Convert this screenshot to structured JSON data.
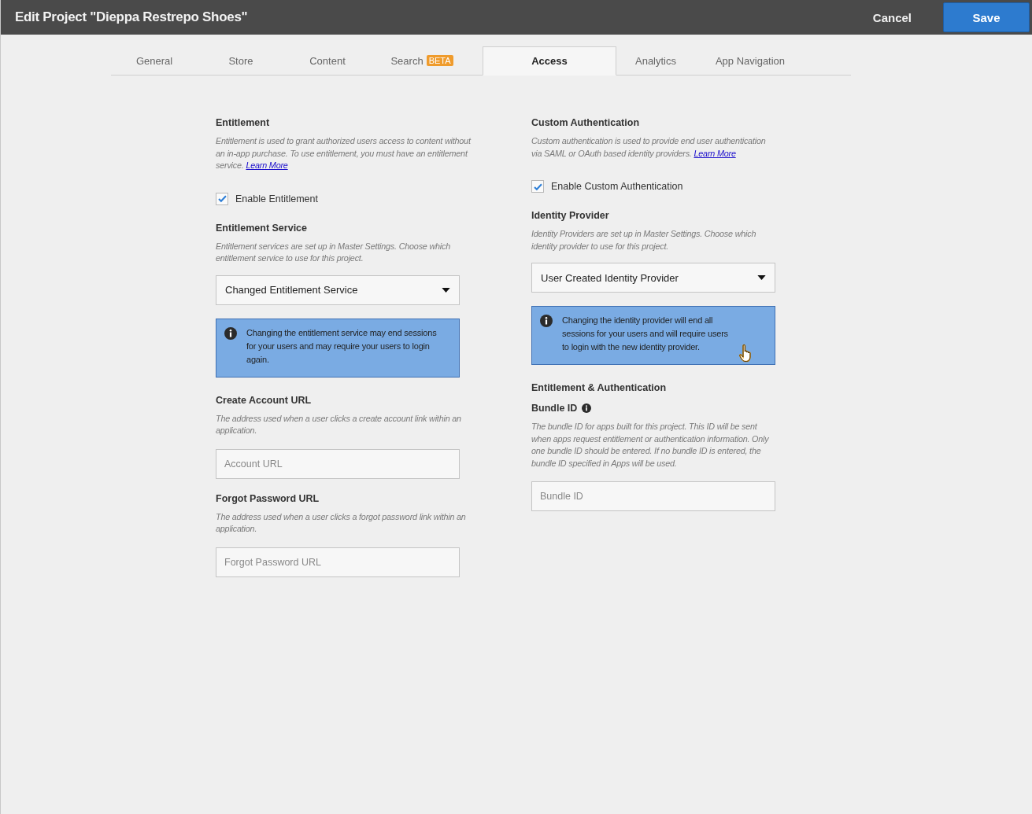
{
  "window": {
    "title": "Edit Project \"Dieppa Restrepo Shoes\""
  },
  "actions": [
    {
      "label": "Cancel",
      "kind": "link"
    },
    {
      "label": "Save",
      "kind": "primary"
    }
  ],
  "tabs": [
    {
      "label": "General",
      "selected": false
    },
    {
      "label": "Store",
      "selected": false
    },
    {
      "label": "Content",
      "selected": false
    },
    {
      "label": "Search",
      "badge": "BETA",
      "selected": false
    },
    {
      "label": "Access",
      "selected": true
    },
    {
      "label": "Analytics",
      "selected": false
    },
    {
      "label": "App Navigation",
      "selected": false
    }
  ],
  "columns": [
    [
      {
        "kind": "heading",
        "text": "Entitlement"
      },
      {
        "kind": "description",
        "text": "Entitlement is used to grant authorized users access to content without an  in-app purchase. To use  entitlement, you must have an entitlement service.",
        "link": "Learn More"
      },
      {
        "kind": "checkbox",
        "label": "Enable Entitlement",
        "checked": true
      },
      {
        "kind": "heading",
        "text": "Entitlement Service"
      },
      {
        "kind": "description",
        "text": "Entitlement services are set up in Master Settings. Choose which entitlement service to use for this  project."
      },
      {
        "kind": "dropdown",
        "value": "Changed Entitlement Service"
      },
      {
        "kind": "alert",
        "text": "Changing the entitlement service may end sessions for your users and may require your users to login again."
      },
      {
        "kind": "heading",
        "text": "Create Account URL"
      },
      {
        "kind": "description",
        "text": "The address used when a user clicks a create account link within an application."
      },
      {
        "kind": "input",
        "placeholder": "Account URL"
      },
      {
        "kind": "heading",
        "text": "Forgot Password URL"
      },
      {
        "kind": "description",
        "text": "The address used when a user clicks a forgot password link within an application."
      },
      {
        "kind": "input",
        "placeholder": "Forgot Password URL"
      }
    ],
    [
      {
        "kind": "heading",
        "text": "Custom Authentication"
      },
      {
        "kind": "description",
        "text": "Custom authentication is used to provide end user authentication via SAML or OAuth based identity providers.",
        "link": "Learn More"
      },
      {
        "kind": "checkbox",
        "label": "Enable Custom Authentication",
        "checked": true
      },
      {
        "kind": "heading",
        "text": "Identity Provider"
      },
      {
        "kind": "description",
        "text": "Identity Providers are set up in Master Settings.  Choose which identity provider to use for this project."
      },
      {
        "kind": "dropdown",
        "value": "User Created Identity Provider"
      },
      {
        "kind": "alert",
        "text": "Changing the identity provider will end all sessions for your users and will require users to login with the new identity provider.",
        "cursor": true
      },
      {
        "kind": "heading",
        "text": "Entitlement & Authentication"
      },
      {
        "kind": "label",
        "text": "Bundle ID",
        "info": true
      },
      {
        "kind": "description",
        "text": "The bundle ID for apps built for this project. This ID will be sent when apps request entitlement or authentication information. Only one bundle ID should be entered. If no bundle ID is entered, the bundle ID specified in Apps will be used."
      },
      {
        "kind": "input",
        "placeholder": "Bundle ID"
      }
    ]
  ]
}
